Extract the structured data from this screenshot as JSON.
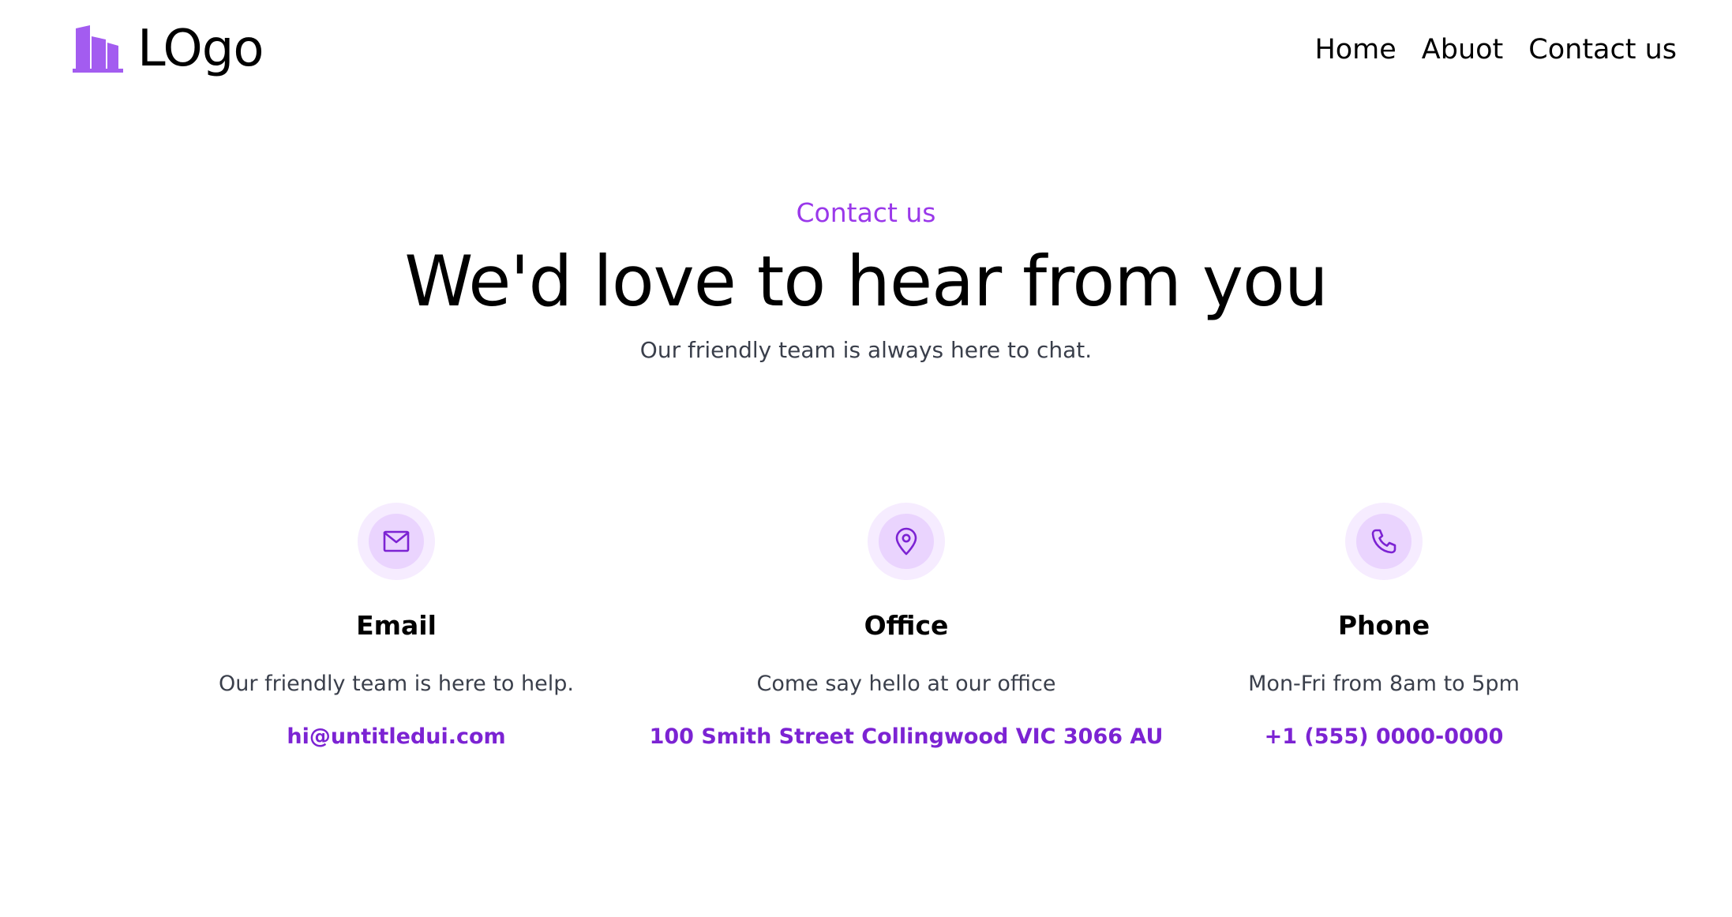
{
  "header": {
    "logo_text": "LOgo",
    "nav": [
      {
        "label": "Home"
      },
      {
        "label": "Abuot"
      },
      {
        "label": "Contact us"
      }
    ]
  },
  "hero": {
    "eyebrow": "Contact us",
    "headline": "We'd love to hear from you",
    "subline": "Our friendly team is always here to chat."
  },
  "cards": [
    {
      "icon": "mail-icon",
      "title": "Email",
      "description": "Our friendly team is here to help.",
      "link": "hi@untitledui.com"
    },
    {
      "icon": "map-pin-icon",
      "title": "Office",
      "description": "Come say hello at our office",
      "link": "100 Smith Street Collingwood VIC 3066 AU"
    },
    {
      "icon": "phone-icon",
      "title": "Phone",
      "description": "Mon-Fri from 8am to 5pm",
      "link": "+1 (555) 0000-0000"
    }
  ],
  "colors": {
    "accent": "#9a38ea",
    "link": "#7c23d3",
    "icon_outer_bg": "#f6ecff",
    "icon_inner_bg": "#ead4fe",
    "logo_icon": "#a35cf0",
    "text_muted": "#3a3f4b"
  }
}
